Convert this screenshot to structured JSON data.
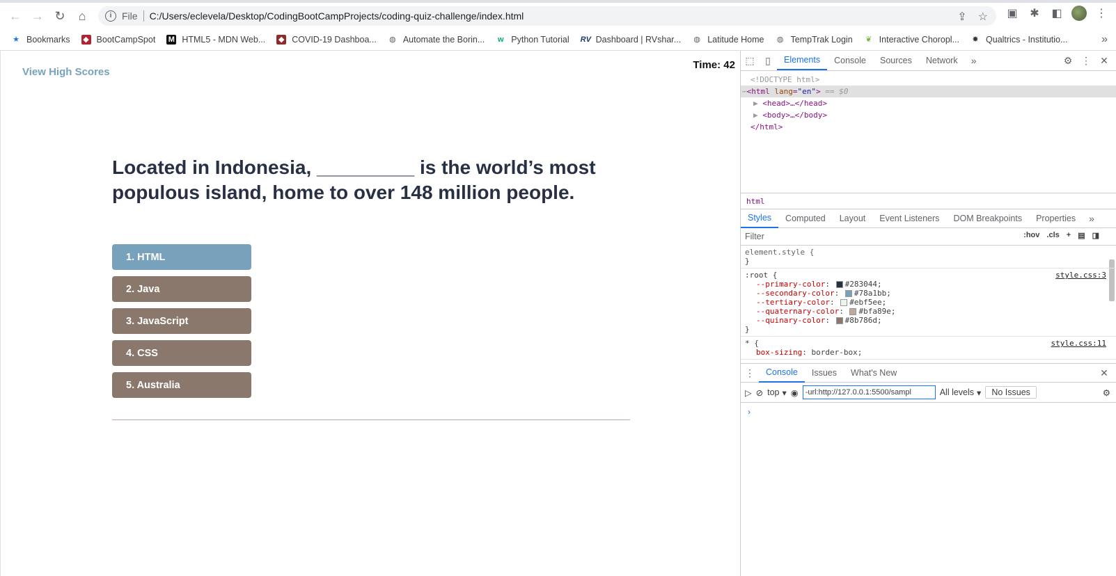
{
  "browser": {
    "address": {
      "scheme": "File",
      "url": "C:/Users/eclevela/Desktop/CodingBootCampProjects/coding-quiz-challenge/index.html"
    },
    "bookmarks": [
      {
        "label": "Bookmarks",
        "icon": "star-icon"
      },
      {
        "label": "BootCampSpot",
        "icon": "shield-icon"
      },
      {
        "label": "HTML5 - MDN Web...",
        "icon": "mdn-icon"
      },
      {
        "label": "COVID-19 Dashboa...",
        "icon": "shield-icon"
      },
      {
        "label": "Automate the Borin...",
        "icon": "globe-icon"
      },
      {
        "label": "Python Tutorial",
        "icon": "w3-icon"
      },
      {
        "label": "Dashboard | RVshar...",
        "icon": "rv-icon"
      },
      {
        "label": "Latitude Home",
        "icon": "globe-icon"
      },
      {
        "label": "TempTrak Login",
        "icon": "globe-icon"
      },
      {
        "label": "Interactive Choropl...",
        "icon": "leaf-icon"
      },
      {
        "label": "Qualtrics - Institutio...",
        "icon": "spider-icon"
      }
    ]
  },
  "page": {
    "high_scores_link": "View High Scores",
    "timer": "Time: 42",
    "question": "Located in Indonesia, _________ is the world’s most populous island, home to over 148 million people.",
    "answers": [
      {
        "label": "1. HTML",
        "selected": true
      },
      {
        "label": "2. Java",
        "selected": false
      },
      {
        "label": "3. JavaScript",
        "selected": false
      },
      {
        "label": "4. CSS",
        "selected": false
      },
      {
        "label": "5. Australia",
        "selected": false
      }
    ],
    "colors": {
      "primary": "#283044",
      "secondary": "#78a1bb",
      "tertiary": "#ebf5ee",
      "quaternary": "#bfa89e",
      "quinary": "#8b786d"
    }
  },
  "devtools": {
    "tabs": [
      "Elements",
      "Console",
      "Sources",
      "Network"
    ],
    "active_tab": "Elements",
    "dom": {
      "doctype": "<!DOCTYPE html>",
      "html_open_tag": "html",
      "html_attr_name": "lang",
      "html_attr_value": "\"en\"",
      "selected_marker": "== $0",
      "head": "<head>…</head>",
      "body": "<body>…</body>",
      "html_close": "</html>"
    },
    "breadcrumb": "html",
    "styles_tabs": [
      "Styles",
      "Computed",
      "Layout",
      "Event Listeners",
      "DOM Breakpoints",
      "Properties"
    ],
    "filter_placeholder": "Filter",
    "filter_tools": [
      ":hov",
      ".cls"
    ],
    "rules": {
      "element_style": "element.style {",
      "close": "}",
      "root_selector": ":root {",
      "root_source": "style.css:3",
      "root_props": [
        {
          "name": "--primary-color",
          "value": "#283044"
        },
        {
          "name": "--secondary-color",
          "value": "#78a1bb"
        },
        {
          "name": "--tertiary-color",
          "value": "#ebf5ee"
        },
        {
          "name": "--quaternary-color",
          "value": "#bfa89e"
        },
        {
          "name": "--quinary-color",
          "value": "#8b786d"
        }
      ],
      "star_selector": "* {",
      "star_source": "style.css:11",
      "star_prop_name": "box-sizing",
      "star_prop_value": "border-box;"
    },
    "drawer": {
      "tabs": [
        "Console",
        "Issues",
        "What's New"
      ],
      "active_tab": "Console",
      "context": "top",
      "url_filter": "-url:http://127.0.0.1:5500/sampl",
      "levels": "All levels",
      "issues": "No Issues",
      "prompt": "›"
    }
  }
}
